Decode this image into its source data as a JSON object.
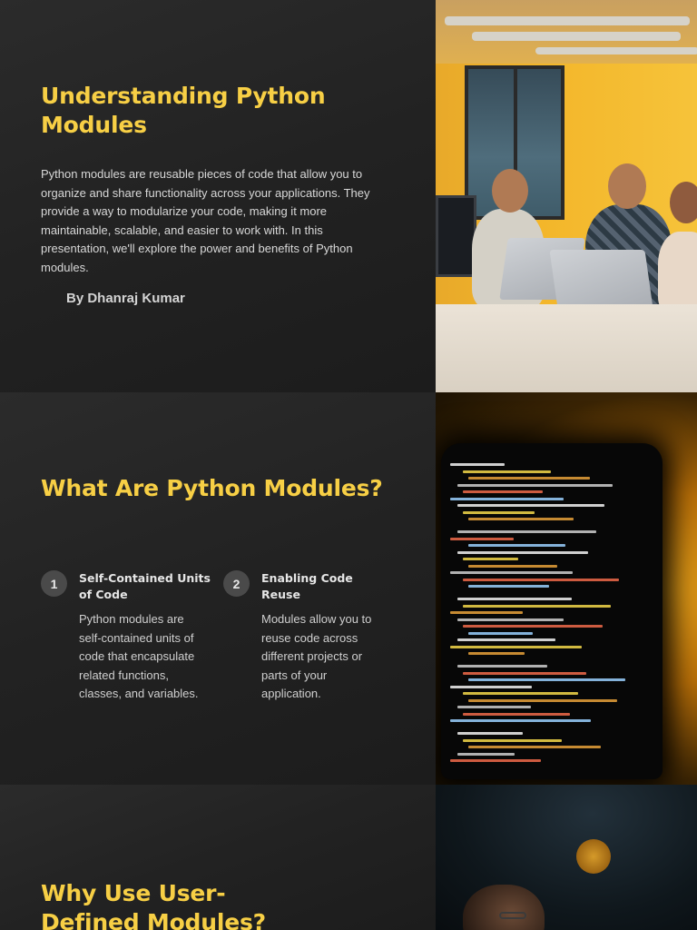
{
  "slides": [
    {
      "title": "Understanding Python Modules",
      "paragraph": "Python modules are reusable pieces of code that allow you to organize and share functionality across your applications. They provide a way to modularize your code, making it more maintainable, scalable, and easier to work with. In this presentation, we'll explore the power and benefits of Python modules.",
      "author": "By Dhanraj Kumar",
      "image_alt": "office-team-photo"
    },
    {
      "title": "What Are Python Modules?",
      "features": [
        {
          "number": "1",
          "title": "Self-Contained Units of Code",
          "body": "Python modules are self-contained units of code that encapsulate related functions, classes, and variables."
        },
        {
          "number": "2",
          "title": "Enabling Code Reuse",
          "body": "Modules allow you to reuse code across different projects or parts of your application."
        }
      ],
      "image_alt": "code-screen-photo"
    },
    {
      "title": "Why Use User-Defined Modules?",
      "image_alt": "developer-portrait-photo"
    }
  ],
  "colors": {
    "accent": "#f7cf45",
    "background": "#232323",
    "body_text": "#d8d8d8",
    "badge": "#4a4a4a"
  }
}
